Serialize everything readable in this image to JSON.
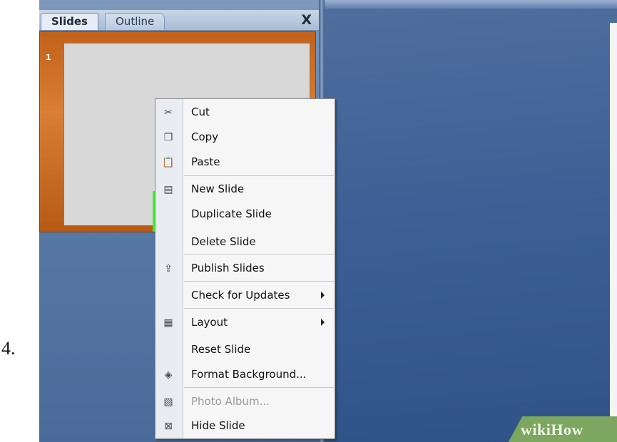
{
  "step_number": "4.",
  "panel": {
    "tabs": [
      {
        "label": "Slides"
      },
      {
        "label": "Outline"
      }
    ],
    "close_glyph": "X",
    "thumbnail_number": "1"
  },
  "menu": {
    "items": [
      {
        "label": "Cut",
        "icon": "scissors-icon",
        "glyph": "✂"
      },
      {
        "label": "Copy",
        "icon": "copy-icon",
        "glyph": "❐"
      },
      {
        "label": "Paste",
        "icon": "paste-icon",
        "glyph": "📋"
      },
      {
        "label": "New Slide",
        "icon": "new-slide-icon",
        "glyph": "▤"
      },
      {
        "label": "Duplicate Slide",
        "icon": "",
        "glyph": ""
      },
      {
        "label": "Delete Slide",
        "icon": "",
        "glyph": ""
      },
      {
        "label": "Publish Slides",
        "icon": "publish-slides-icon",
        "glyph": "⇪"
      },
      {
        "label": "Check for Updates",
        "icon": "",
        "glyph": "",
        "submenu": true
      },
      {
        "label": "Layout",
        "icon": "layout-icon",
        "glyph": "▦",
        "submenu": true
      },
      {
        "label": "Reset Slide",
        "icon": "",
        "glyph": ""
      },
      {
        "label": "Format Background...",
        "icon": "format-background-icon",
        "glyph": "◈"
      },
      {
        "label": "Photo Album...",
        "icon": "photo-album-icon",
        "glyph": "▧",
        "disabled": true
      },
      {
        "label": "Hide Slide",
        "icon": "hide-slide-icon",
        "glyph": "⊠"
      }
    ]
  },
  "highlight_color": "#39f22b",
  "watermark": "wikiHow"
}
